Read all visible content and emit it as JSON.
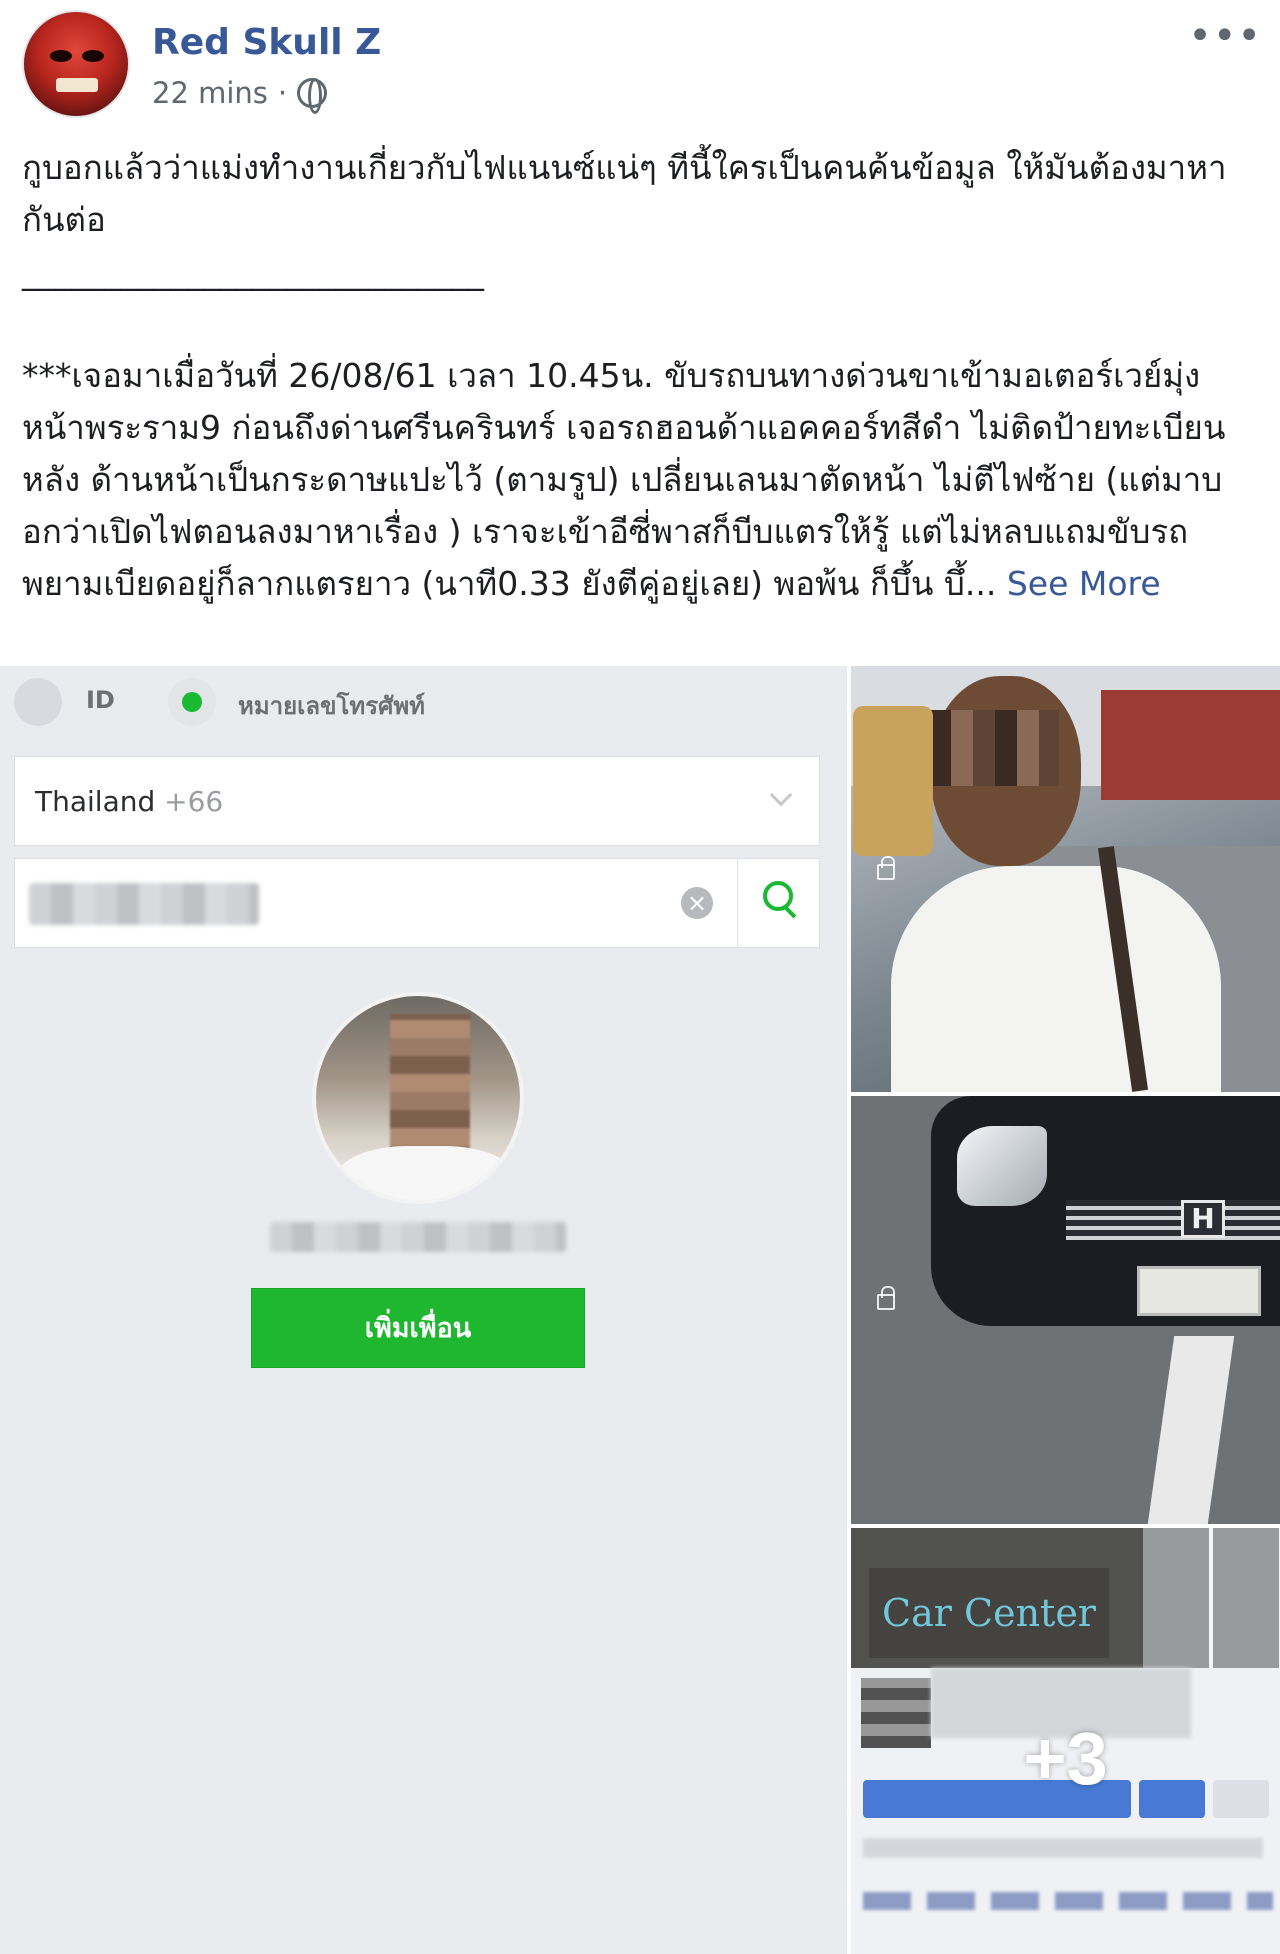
{
  "post": {
    "author": "Red Skull Z",
    "time": "22 mins",
    "separator": "·",
    "more_icon": "•••",
    "text_line_1": "กูบอกแล้วว่าแม่งทำงานเกี่ยวกับไฟแนนซ์แน่ๆ ทีนี้ใครเป็นคนค้นข้อมูล ให้มันต้องมาหากันต่อ",
    "divider": "____________________________",
    "text_line_2": "***เจอมาเมื่อวันที่ 26/08/61 เวลา 10.45น. ขับรถบนทางด่วนขาเข้ามอเตอร์เวย์มุ่งหน้าพระราม9 ก่อนถึงด่านศรีนครินทร์ เจอรถฮอนด้าแอคคอร์ทสีดำ ไม่ติดป้ายทะเบียนหลัง ด้านหน้าเป็นกระดาษแปะไว้ (ตามรูป) เปลี่ยนเลนมาตัดหน้า ไม่ตีไฟซ้าย (แต่มาบอกว่าเปิดไฟตอนลงมาหาเรื่อง ) เราจะเข้าอีซี่พาสก็บีบแตรให้รู้ แต่ไม่หลบแถมขับรถพยามเบียดอยู่ก็ลากแตรยาว (นาที0.33 ยังตีคู่อยู่เลย) พอพ้น ก็บึ้น บึ้...",
    "see_more": "See More"
  },
  "line_screenshot": {
    "radio_id_label": "ID",
    "radio_phone_label": "หมายเลขโทรศัพท์",
    "country_name": "Thailand",
    "country_code": "+66",
    "clear_glyph": "×",
    "add_friend_button": "เพิ่มเพื่อน"
  },
  "photos": {
    "car_center_sign": "Car Center",
    "honda_logo": "H",
    "more_photos_count": "+3"
  },
  "colors": {
    "author_link": "#385898",
    "line_green": "#1fb72f",
    "facebook_blue": "#2f68d0"
  }
}
